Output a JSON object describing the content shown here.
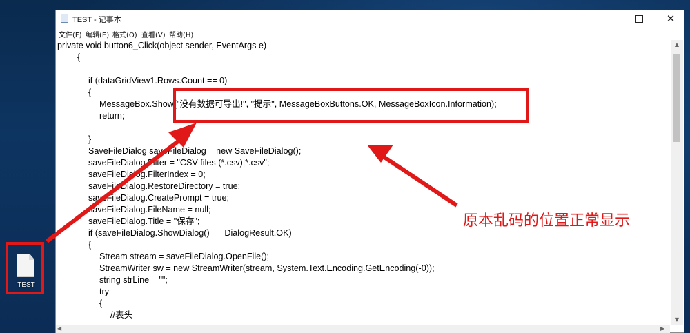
{
  "window": {
    "title": "TEST - 记事本",
    "controls": {
      "minimize": "—",
      "close": "✕"
    }
  },
  "menu": [
    "文件(F)",
    "编辑(E)",
    "格式(O)",
    "查看(V)",
    "帮助(H)"
  ],
  "code_lines": [
    "private void button6_Click(object sender, EventArgs e)",
    "{",
    "",
    "if (dataGridView1.Rows.Count == 0)",
    "{",
    "MessageBox.Show(\"没有数据可导出!\", \"提示\", MessageBoxButtons.OK, MessageBoxIcon.Information);",
    "return;",
    "",
    "}",
    "SaveFileDialog saveFileDialog = new SaveFileDialog();",
    "saveFileDialog.Filter = \"CSV files (*.csv)|*.csv\";",
    "saveFileDialog.FilterIndex = 0;",
    "saveFileDialog.RestoreDirectory = true;",
    "saveFileDialog.CreatePrompt = true;",
    "saveFileDialog.FileName = null;",
    "saveFileDialog.Title = \"保存\";",
    "if (saveFileDialog.ShowDialog() == DialogResult.OK)",
    "{",
    "Stream stream = saveFileDialog.OpenFile();",
    "StreamWriter sw = new StreamWriter(stream, System.Text.Encoding.GetEncoding(-0));",
    "string strLine = \"\";",
    "try",
    "{",
    "//表头"
  ],
  "desktop_icon": {
    "label": "TEST"
  },
  "annotation": {
    "text": "原本乱码的位置正常显示",
    "color": "#e01818"
  },
  "scrollbar": {
    "up": "▲",
    "down": "▼",
    "left": "◀",
    "right": "▶"
  }
}
